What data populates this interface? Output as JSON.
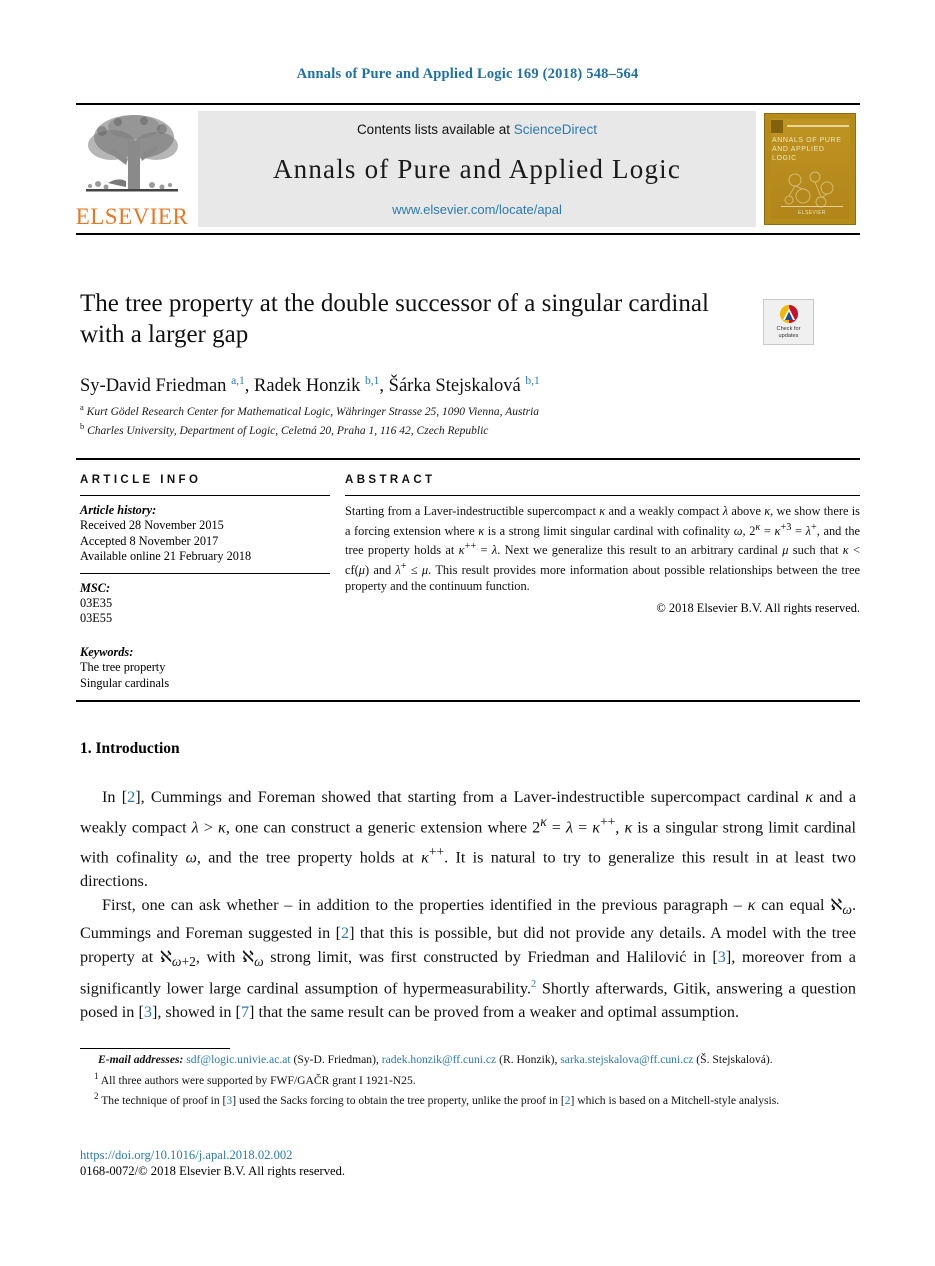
{
  "running_head": "Annals of Pure and Applied Logic 169 (2018) 548–564",
  "masthead": {
    "publisher_wordmark": "ELSEVIER",
    "contents_prefix": "Contents lists available at ",
    "contents_link": "ScienceDirect",
    "journal_name": "Annals of Pure and Applied Logic",
    "journal_url": "www.elsevier.com/locate/apal",
    "cover_title": "ANNALS OF PURE AND APPLIED LOGIC",
    "cover_footer": "ELSEVIER"
  },
  "article": {
    "title": "The tree property at the double successor of a singular cardinal with a larger gap",
    "authors_html": "Sy-David Friedman <sup class=\"aff-mark\">a,1</sup>, Radek Honzik <sup class=\"aff-mark\">b,1</sup>, Šárka Stejskalová <sup class=\"aff-mark\">b,1</sup>",
    "affiliation_a": "Kurt Gödel Research Center for Mathematical Logic, Währinger Strasse 25, 1090 Vienna, Austria",
    "affiliation_b": "Charles University, Department of Logic, Celetná 20, Praha 1, 116 42, Czech Republic",
    "crossmark_label_line1": "Check for",
    "crossmark_label_line2": "updates"
  },
  "article_info": {
    "heading": "ARTICLE INFO",
    "history_label": "Article history:",
    "history": [
      "Received 28 November 2015",
      "Accepted 8 November 2017",
      "Available online 21 February 2018"
    ],
    "msc_label": "MSC:",
    "msc": [
      "03E35",
      "03E55"
    ],
    "keywords_label": "Keywords:",
    "keywords": [
      "The tree property",
      "Singular cardinals"
    ]
  },
  "abstract": {
    "heading": "ABSTRACT",
    "body_html": "Starting from a Laver-indestructible supercompact <i>κ</i> and a weakly compact <i>λ</i> above <i>κ</i>, we show there is a forcing extension where <i>κ</i> is a strong limit singular cardinal with cofinality <i>ω</i>, 2<sup><i>κ</i></sup> = <i>κ</i><sup>+3</sup> = <i>λ</i><sup>+</sup>, and the tree property holds at <i>κ</i><sup>++</sup> = <i>λ</i>. Next we generalize this result to an arbitrary cardinal <i>μ</i> such that <i>κ</i> &lt; cf(<i>μ</i>) and <i>λ</i><sup>+</sup> ≤ <i>μ</i>. This result provides more information about possible relationships between the tree property and the continuum function.",
    "copyright": "© 2018 Elsevier B.V. All rights reserved."
  },
  "body": {
    "section_number_title": "1. Introduction",
    "paragraph1_html": "In [<span class=\"ref\">2</span>], Cummings and Foreman showed that starting from a Laver-indestructible supercompact cardinal <i>κ</i> and a weakly compact <i>λ</i> &gt; <i>κ</i>, one can construct a generic extension where 2<sup><i>κ</i></sup> = <i>λ</i> = <i>κ</i><sup>++</sup>, <i>κ</i> is a singular strong limit cardinal with cofinality <i>ω</i>, and the tree property holds at <i>κ</i><sup>++</sup>. It is natural to try to generalize this result in at least two directions.",
    "paragraph2_html": "First, one can ask whether – in addition to the properties identified in the previous paragraph – <i>κ</i> can equal ℵ<sub><i>ω</i></sub>. Cummings and Foreman suggested in [<span class=\"ref\">2</span>] that this is possible, but did not provide any details. A model with the tree property at ℵ<sub><i>ω</i>+2</sub>, with ℵ<sub><i>ω</i></sub> strong limit, was first constructed by Friedman and Halilović in [<span class=\"ref\">3</span>], moreover from a significantly lower large cardinal assumption of hypermeasurability.<sup class=\"fn\">2</sup> Shortly afterwards, Gitik, answering a question posed in [<span class=\"ref\">3</span>], showed in [<span class=\"ref\">7</span>] that the same result can be proved from a weaker and optimal assumption."
  },
  "footnotes": {
    "email_label": "E-mail addresses:",
    "email_line_html": "<em>E-mail addresses:</em> <span class=\"link\">sdf@logic.univie.ac.at</span> (Sy-D. Friedman), <span class=\"link\">radek.honzik@ff.cuni.cz</span> (R. Honzik), <span class=\"link\">sarka.stejskalova@ff.cuni.cz</span> (Š. Stejskalová).",
    "note1_html": "<span class=\"fnum\">1</span> All three authors were supported by FWF/GAČR grant I 1921-N25.",
    "note2_html": "<span class=\"fnum\">2</span> The technique of proof in [<span class=\"ref\">3</span>] used the Sacks forcing to obtain the tree property, unlike the proof in [<span class=\"ref\">2</span>] which is based on a Mitchell-style analysis."
  },
  "footer": {
    "doi": "https://doi.org/10.1016/j.apal.2018.02.002",
    "issn_copyright": "0168-0072/© 2018 Elsevier B.V. All rights reserved."
  },
  "colors": {
    "link_blue": "#2a7ab0",
    "running_head_blue": "#1f6fa8",
    "elsevier_orange": "#e87722",
    "cover_gold": "#b58b1a"
  }
}
